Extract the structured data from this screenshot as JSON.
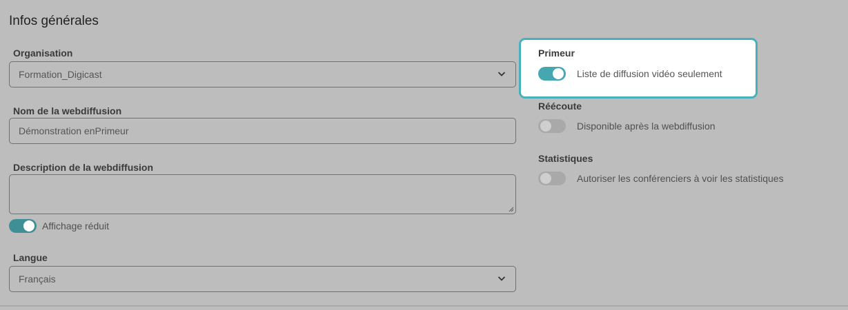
{
  "section": {
    "title": "Infos générales"
  },
  "organisation": {
    "label": "Organisation",
    "value": "Formation_Digicast"
  },
  "webcast_name": {
    "label": "Nom de la webdiffusion",
    "value": "Démonstration enPrimeur"
  },
  "description": {
    "label": "Description de la webdiffusion",
    "value": ""
  },
  "compact_view": {
    "label": "Affichage réduit",
    "on": true
  },
  "language": {
    "label": "Langue",
    "value": "Français"
  },
  "premiere": {
    "title": "Primeur",
    "toggle_label": "Liste de diffusion vidéo seulement",
    "on": true
  },
  "replay": {
    "title": "Réécoute",
    "toggle_label": "Disponible après la webdiffusion",
    "on": false
  },
  "stats": {
    "title": "Statistiques",
    "toggle_label": "Autoriser les conférenciers à voir les statistiques",
    "on": false
  },
  "colors": {
    "toggle_on": "#45a7b0",
    "toggle_on_dimmed": "#3e8f96",
    "toggle_off": "#a9a9a9",
    "highlight_border": "#47b0bd",
    "overlay_bg": "#bdbdbd"
  }
}
